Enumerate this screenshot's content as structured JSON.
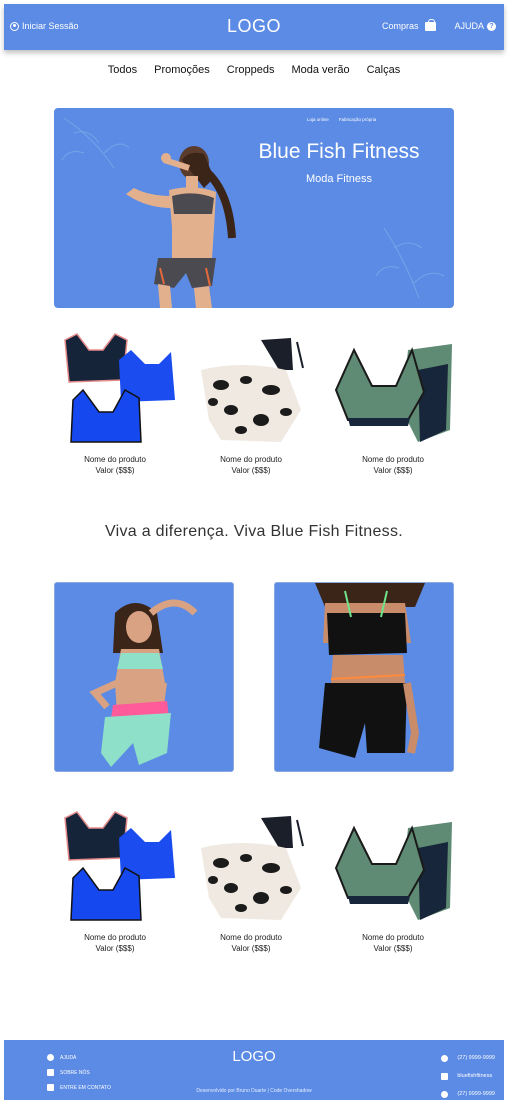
{
  "header": {
    "login_label": "Iniciar Sessão",
    "logo": "LOGO",
    "cart_label": "Compras",
    "help_label": "AJUDA"
  },
  "nav": [
    "Todos",
    "Promoções",
    "Croppeds",
    "Moda verão",
    "Calças"
  ],
  "banner": {
    "mini_links": [
      "Loja online",
      "Fabricação própria"
    ],
    "title": "Blue Fish Fitness",
    "subtitle": "Moda Fitness"
  },
  "products_top": [
    {
      "name": "Nome do produto",
      "value": "Valor ($$$)"
    },
    {
      "name": "Nome do produto",
      "value": "Valor ($$$)"
    },
    {
      "name": "Nome do produto",
      "value": "Valor ($$$)"
    }
  ],
  "slogan": "Viva a diferença. Viva Blue Fish Fitness.",
  "products_bottom": [
    {
      "name": "Nome do produto",
      "value": "Valor ($$$)"
    },
    {
      "name": "Nome do produto",
      "value": "Valor ($$$)"
    },
    {
      "name": "Nome do produto",
      "value": "Valor ($$$)"
    }
  ],
  "footer": {
    "links": [
      "AJUDA",
      "SOBRE NÓS",
      "ENTRE EM CONTATO"
    ],
    "logo": "LOGO",
    "credit": "Desenvolvido por Bruno Duarte | Code Overshadow",
    "contacts": [
      "(27) 9999-9999",
      "bluefishfitness",
      "(27) 9999-9999"
    ]
  },
  "colors": {
    "brand": "#5b8be4",
    "text": "#222222"
  }
}
